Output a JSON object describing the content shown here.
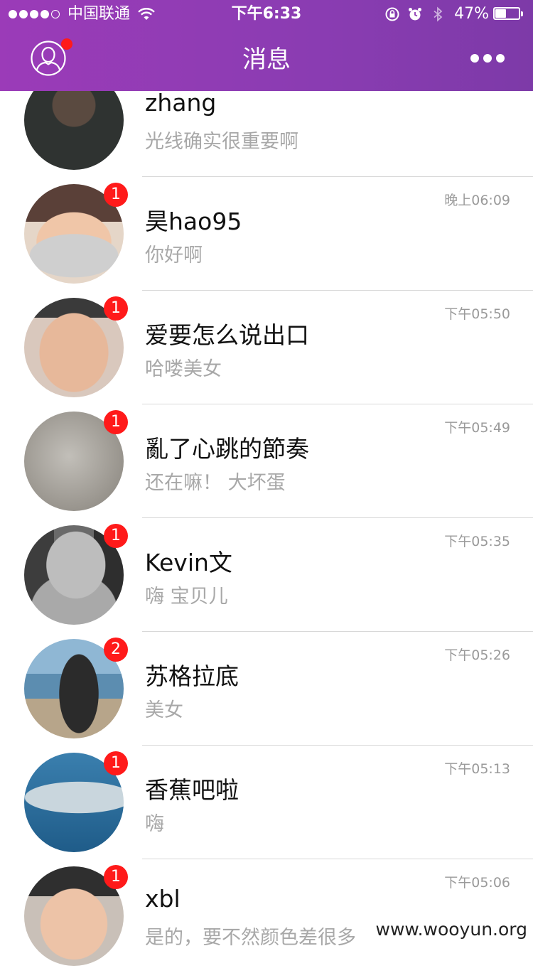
{
  "status_bar": {
    "carrier": "中国联通",
    "time": "下午6:33",
    "battery": "47%",
    "battery_level": 0.47,
    "signal_bars_filled": 4,
    "signal_bars_total": 5
  },
  "nav": {
    "title": "消息"
  },
  "messages": [
    {
      "name": "zhang",
      "preview": "光线确实很重要啊",
      "time": "",
      "badge": ""
    },
    {
      "name": "昊hao95",
      "preview": "你好啊",
      "time": "晚上06:09",
      "badge": "1"
    },
    {
      "name": "爱要怎么说出口",
      "preview": "哈喽美女",
      "time": "下午05:50",
      "badge": "1"
    },
    {
      "name": "亂了心跳的節奏",
      "preview": "还在嘛！ 大坏蛋",
      "time": "下午05:49",
      "badge": "1"
    },
    {
      "name": "Kevin文",
      "preview": "嗨 宝贝儿",
      "time": "下午05:35",
      "badge": "1"
    },
    {
      "name": "苏格拉底",
      "preview": "美女",
      "time": "下午05:26",
      "badge": "2"
    },
    {
      "name": "香蕉吧啦",
      "preview": "嗨",
      "time": "下午05:13",
      "badge": "1"
    },
    {
      "name": "xbl",
      "preview": "是的，要不然颜色差很多",
      "time": "下午05:06",
      "badge": "1"
    }
  ],
  "watermark": "www.wooyun.org",
  "colors": {
    "header": "#8f3bb4",
    "badge": "#ff1a1a",
    "preview_text": "#a8a8a8",
    "divider": "#d8d8d8"
  },
  "icons": {
    "profile": "user-outline-icon",
    "more": "more-dots-icon",
    "wifi": "wifi-icon",
    "rotation_lock": "rotation-lock-icon",
    "alarm": "alarm-icon",
    "bluetooth": "bluetooth-icon"
  }
}
